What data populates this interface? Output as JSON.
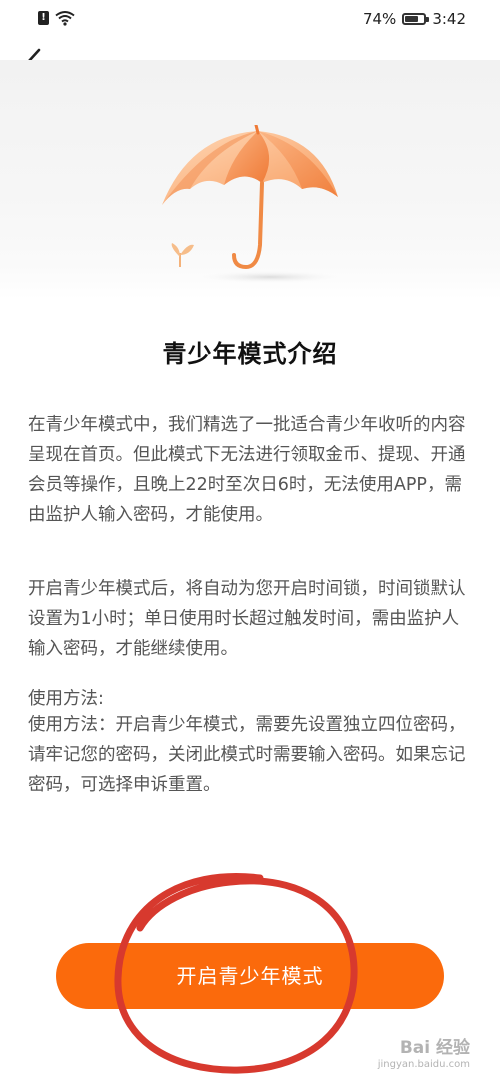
{
  "status_bar": {
    "battery_percent": "74%",
    "time": "3:42",
    "battery_level": 0.74
  },
  "header": {
    "back_icon": "chevron-left-icon"
  },
  "hero": {
    "illustration": "umbrella-icon"
  },
  "title": "青少年模式介绍",
  "paragraphs": [
    "在青少年模式中，我们精选了一批适合青少年收听的内容呈现在首页。但此模式下无法进行领取金币、提现、开通会员等操作，且晚上22时至次日6时，无法使用APP，需由监护人输入密码，才能使用。",
    "开启青少年模式后，将自动为您开启时间锁，时间锁默认设置为1小时；单日使用时长超过触发时间，需由监护人输入密码，才能继续使用。"
  ],
  "usage": {
    "heading": "使用方法:",
    "body": "使用方法：开启青少年模式，需要先设置独立四位密码，请牢记您的密码，关闭此模式时需要输入密码。如果忘记密码，可选择申诉重置。"
  },
  "cta_label": "开启青少年模式",
  "colors": {
    "accent": "#fb6a0c",
    "annotation": "#d7392e"
  },
  "watermark": {
    "brand": "Bai 经验",
    "url": "jingyan.baidu.com"
  }
}
